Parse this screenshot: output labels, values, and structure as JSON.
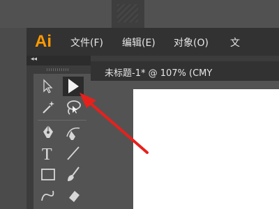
{
  "app": {
    "logo_text": "Ai"
  },
  "menu": {
    "items": [
      {
        "label": "文件(F)"
      },
      {
        "label": "编辑(E)"
      },
      {
        "label": "对象(O)"
      },
      {
        "label": "文"
      }
    ]
  },
  "document_tab": {
    "title": "未标题-1* @ 107% (CMY"
  },
  "toolbar": {
    "collapse_glyph": "◂◂",
    "tools": [
      {
        "icon": "selection-tool-icon",
        "selected": false
      },
      {
        "icon": "direct-selection-tool-icon",
        "selected": true
      },
      {
        "icon": "magic-wand-tool-icon",
        "selected": false
      },
      {
        "icon": "lasso-tool-icon",
        "selected": false
      },
      {
        "icon": "pen-tool-icon",
        "selected": false
      },
      {
        "icon": "curvature-tool-icon",
        "selected": false
      },
      {
        "icon": "type-tool-icon",
        "selected": false,
        "glyph": "T"
      },
      {
        "icon": "line-segment-tool-icon",
        "selected": false
      },
      {
        "icon": "rectangle-tool-icon",
        "selected": false
      },
      {
        "icon": "paintbrush-tool-icon",
        "selected": false
      },
      {
        "icon": "shaper-tool-icon",
        "selected": false
      },
      {
        "icon": "eraser-tool-icon",
        "selected": false
      }
    ]
  },
  "annotation": {
    "arrow_color": "#e8201c"
  },
  "colors": {
    "logo": "#ff9a00",
    "menubar": "#323232",
    "panel": "#535353"
  }
}
